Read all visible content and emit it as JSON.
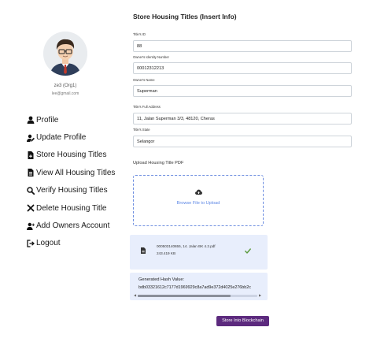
{
  "sidebar": {
    "user_name": "ze3 (Org1)",
    "user_email": "lee@gmail.com",
    "items": [
      {
        "label": "Profile",
        "icon": "user-icon"
      },
      {
        "label": "Update Profile",
        "icon": "user-edit-icon"
      },
      {
        "label": "Store Housing Titles",
        "icon": "file-plus-icon"
      },
      {
        "label": "View All Housing Titles",
        "icon": "file-list-icon"
      },
      {
        "label": "Verify Housing Titles",
        "icon": "search-icon"
      },
      {
        "label": "Delete Housing Title",
        "icon": "x-icon"
      },
      {
        "label": "Add Owners Account",
        "icon": "user-plus-icon"
      },
      {
        "label": "Logout",
        "icon": "logout-icon"
      }
    ]
  },
  "main": {
    "title": "Store Housing Titles (Insert Info)",
    "fields": {
      "title_id": {
        "label": "Title's ID",
        "value": "88"
      },
      "owner_id": {
        "label": "Owner's Identity Number",
        "value": "00012312213"
      },
      "owner_name": {
        "label": "Owner's Name",
        "value": "Superman"
      },
      "address": {
        "label": "Title's Full Address",
        "value": "11, Jalan Superman 3/3, 48120, Cheras"
      },
      "state": {
        "label": "Title's State",
        "value": "Selangor"
      }
    },
    "upload": {
      "label": "Upload Housing Title PDF",
      "browse": "Browse File to Upload",
      "file_name": "000503140655, 14. Jalan BK 4.2.pdf",
      "file_size": "243.419 KB"
    },
    "hash": {
      "label": "Generated Hash Value:",
      "value": "bdb03321612c7177d1969929c8a7ad9e372d4025e276bb2c"
    },
    "submit_label": "Store Into Blockchain"
  },
  "colors": {
    "button": "#5c2a7e",
    "accent_link": "#5b86e5",
    "card_bg": "#e8eefc",
    "check": "#5a9a3c"
  }
}
